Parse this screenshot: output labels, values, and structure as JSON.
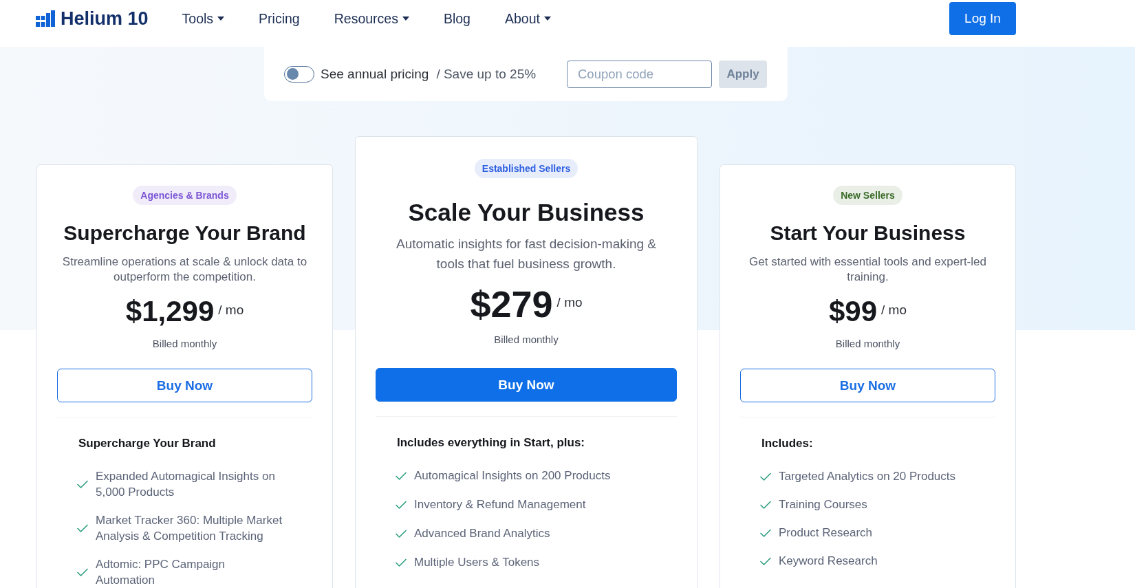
{
  "header": {
    "logo": {
      "text": "Helium 10"
    },
    "nav": [
      {
        "label": "Tools",
        "dropdown": true
      },
      {
        "label": "Pricing",
        "dropdown": false
      },
      {
        "label": "Resources",
        "dropdown": true
      },
      {
        "label": "Blog",
        "dropdown": false
      },
      {
        "label": "About",
        "dropdown": true
      }
    ],
    "login_button": "Log In"
  },
  "pricing_bar": {
    "annual_toggle": {
      "on": false,
      "label": "See annual pricing",
      "note": "/ Save up to 25%"
    },
    "coupon": {
      "placeholder": "Coupon code"
    },
    "apply_button": {
      "label": "Apply",
      "disabled": true
    }
  },
  "plans": [
    {
      "badge": {
        "text": "Agencies & Brands",
        "color": "#7b55d4"
      },
      "featured": false,
      "title": "Supercharge Your Brand",
      "description": "Streamline operations at scale & unlock data to outperform the competition.",
      "price": "$1,299",
      "period": "/ mo",
      "billing": "Billed monthly",
      "button": "Buy Now",
      "features_heading": "Supercharge Your Brand",
      "features": [
        "Expanded Automagical Insights on 5,000 Products",
        "Market Tracker 360: Multiple Market Analysis & Competition Tracking",
        "Adtomic: PPC Campaign Automation"
      ]
    },
    {
      "badge": {
        "text": "Established Sellers",
        "color": "#2c5fe0"
      },
      "featured": true,
      "title": "Scale Your Business",
      "description": "Automatic insights for fast decision-making & tools that fuel business growth.",
      "price": "$279",
      "period": "/ mo",
      "billing": "Billed monthly",
      "button": "Buy Now",
      "features_heading": "Includes everything in Start, plus:",
      "features": [
        "Automagical Insights on 200 Products",
        "Inventory & Refund Management",
        "Advanced Brand Analytics",
        "Multiple Users & Tokens"
      ]
    },
    {
      "badge": {
        "text": "New Sellers",
        "color": "#3a6a28"
      },
      "featured": false,
      "title": "Start Your Business",
      "description": "Get started with essential tools and expert-led training.",
      "price": "$99",
      "period": "/ mo",
      "billing": "Billed monthly",
      "button": "Buy Now",
      "features_heading": "Includes:",
      "features": [
        "Targeted Analytics on 20 Products",
        "Training Courses",
        "Product Research",
        "Keyword Research"
      ]
    }
  ]
}
